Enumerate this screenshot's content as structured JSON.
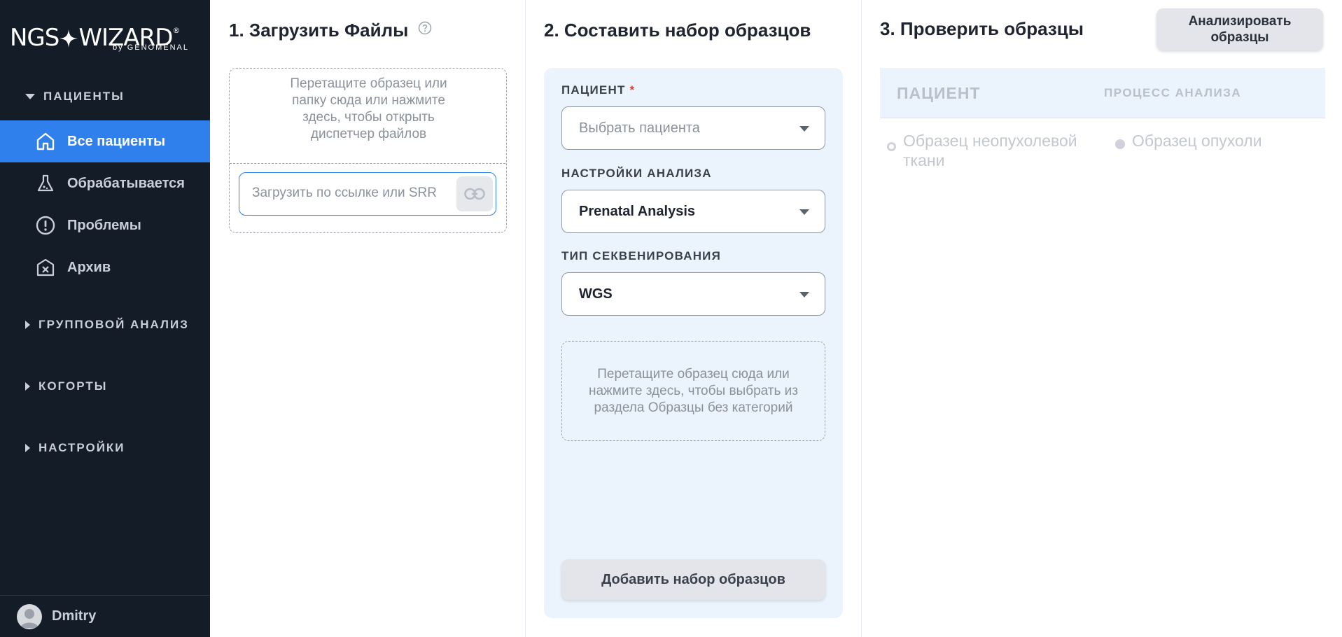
{
  "brand": {
    "logo_left": "NGS",
    "logo_right": "WIZARD",
    "logo_reg": "®",
    "logo_sub": "by GENOMENAL"
  },
  "sidebar": {
    "patients_section": "ПАЦИЕНТЫ",
    "items": [
      {
        "label": "Все пациенты",
        "icon": "home-icon",
        "active": true
      },
      {
        "label": "Обрабатывается",
        "icon": "flask-icon",
        "active": false
      },
      {
        "label": "Проблемы",
        "icon": "alert-icon",
        "active": false
      },
      {
        "label": "Архив",
        "icon": "archive-icon",
        "active": false
      }
    ],
    "group_analysis": "ГРУППОВОЙ АНАЛИЗ",
    "cohorts": "КОГОРТЫ",
    "settings": "НАСТРОЙКИ",
    "user_name": "Dmitry"
  },
  "step1": {
    "title": "1. Загрузить Файлы",
    "drop_text": "Перетащите образец или папку сюда или нажмите здесь, чтобы открыть диспетчер файлов",
    "url_placeholder": "Загрузить по ссылке или SRR"
  },
  "step2": {
    "title": "2. Составить набор образцов",
    "patient_label": "ПАЦИЕНТ",
    "required_mark": "*",
    "patient_placeholder": "Выбрать пациента",
    "analysis_label": "НАСТРОЙКИ АНАЛИЗА",
    "analysis_value": "Prenatal Analysis",
    "seq_label": "ТИП СЕКВЕНИРОВАНИЯ",
    "seq_value": "WGS",
    "drop_text": "Перетащите образец сюда или нажмите здесь, чтобы выбрать из раздела Образцы без категорий",
    "add_button": "Добавить набор образцов"
  },
  "step3": {
    "title": "3. Проверить образцы",
    "analyze_button": "Анализировать образцы",
    "col_patient": "ПАЦИЕНТ",
    "col_process": "ПРОЦЕСС АНАЛИЗА",
    "normal_sample": "Образец неопухолевой ткани",
    "tumor_sample": "Образец опухоли"
  },
  "colors": {
    "sidebar_bg": "#141c28",
    "accent": "#2f80ed",
    "panel_bg": "#ebf3fd",
    "required": "#e53935"
  }
}
